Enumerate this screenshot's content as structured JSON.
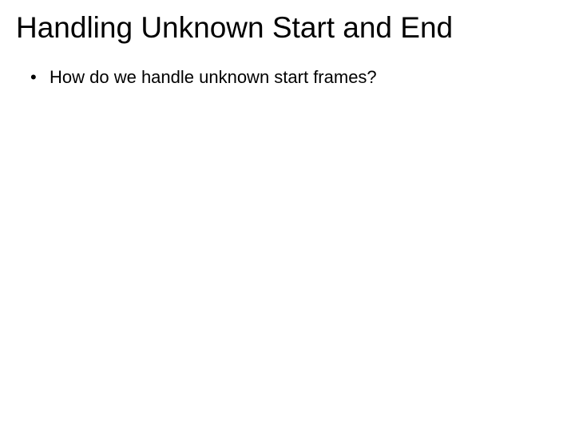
{
  "slide": {
    "title": "Handling Unknown Start and End",
    "bullets": [
      "How do we handle unknown start frames?"
    ]
  }
}
